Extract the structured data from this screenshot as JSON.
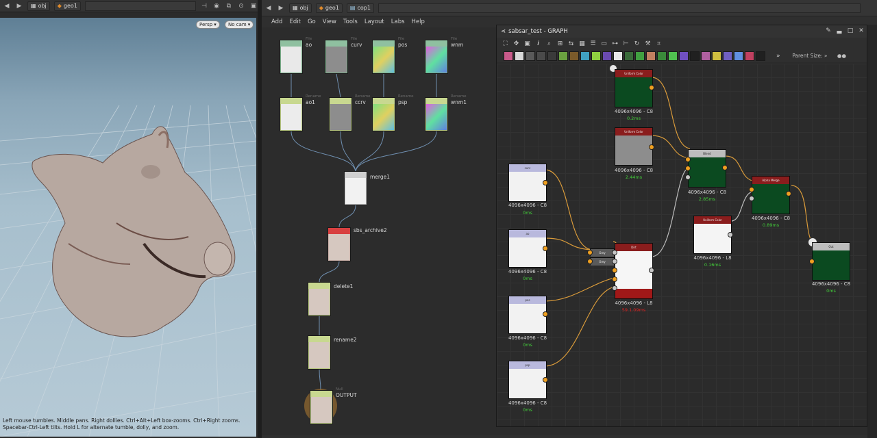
{
  "viewport": {
    "breadcrumb": [
      "obj",
      "geo1"
    ],
    "camera_menus": [
      "Persp",
      "No cam"
    ],
    "status_text": "Left mouse tumbles. Middle pans. Right dollies. Ctrl+Alt+Left box-zooms. Ctrl+Right zooms. Spacebar-Ctrl-Left tilts. Hold L for alternate tumble, dolly, and zoom."
  },
  "network": {
    "breadcrumb": [
      "obj",
      "geo1",
      "cop1"
    ],
    "menu": [
      "Add",
      "Edit",
      "Go",
      "View",
      "Tools",
      "Layout",
      "Labs",
      "Help"
    ],
    "nodes": {
      "file_ao": {
        "type": "File",
        "label": "ao"
      },
      "file_curv": {
        "type": "File",
        "label": "curv"
      },
      "file_pos": {
        "type": "File",
        "label": "pos"
      },
      "file_wnm": {
        "type": "File",
        "label": "wnm"
      },
      "rename_ao1": {
        "type": "Rename",
        "label": "ao1"
      },
      "rename_ccrv": {
        "type": "Rename",
        "label": "ccrv"
      },
      "rename_psp": {
        "type": "Rename",
        "label": "psp"
      },
      "rename_wnm1": {
        "type": "Rename",
        "label": "wnm1"
      },
      "merge1": {
        "label": "merge1"
      },
      "sbs_archive2": {
        "label": "sbs_archive2"
      },
      "delete1": {
        "label": "delete1"
      },
      "rename2": {
        "label": "rename2"
      },
      "output": {
        "type": "Null",
        "label": "OUTPUT"
      }
    }
  },
  "graph": {
    "title": "sabsar_test - GRAPH",
    "parent_size_label": "Parent Size:",
    "parent_size_value": "»",
    "nodes": {
      "uc1": {
        "header": "Uniform Color",
        "size": "4096x4096 - C8",
        "time": "0.2ms"
      },
      "uc2": {
        "header": "Uniform Color",
        "size": "4096x4096 - C8",
        "time": "2.44ms"
      },
      "blend": {
        "header": "Blend",
        "size": "4096x4096 - C8",
        "time": "2.85ms"
      },
      "alpha_merge": {
        "header": "Alpha Merge",
        "size": "4096x4096 - C8",
        "time": "0.89ms"
      },
      "uc3": {
        "header": "Uniform Color",
        "size": "4096x4096 - L8",
        "time": "0.16ms"
      },
      "out": {
        "header": "Out",
        "size": "4096x4096 - C8",
        "time": "0ms"
      },
      "in_curv": {
        "header": "curv",
        "size": "4096x4096 - C8",
        "time": "0ms"
      },
      "in_ao": {
        "header": "ao",
        "size": "4096x4096 - C8",
        "time": "0ms"
      },
      "in_pos": {
        "header": "pos",
        "size": "4096x4096 - C8",
        "time": "0ms"
      },
      "in_psp": {
        "header": "psp",
        "size": "4096x4096 - C8",
        "time": "0ms"
      },
      "gray1": {
        "header": "Grey"
      },
      "gray2": {
        "header": "Grey"
      },
      "dirt": {
        "header": "Dirt",
        "size": "4096x4096 - L8",
        "time": "59.1.09ms"
      }
    }
  },
  "colors": {
    "uniform_green": "#0b4a20",
    "node_header_red": "#8a1d1d",
    "node_header_purple": "#b9b9dd",
    "wire_orange": "#d89a3a",
    "time_green": "#43d13a",
    "time_red": "#e02020"
  }
}
